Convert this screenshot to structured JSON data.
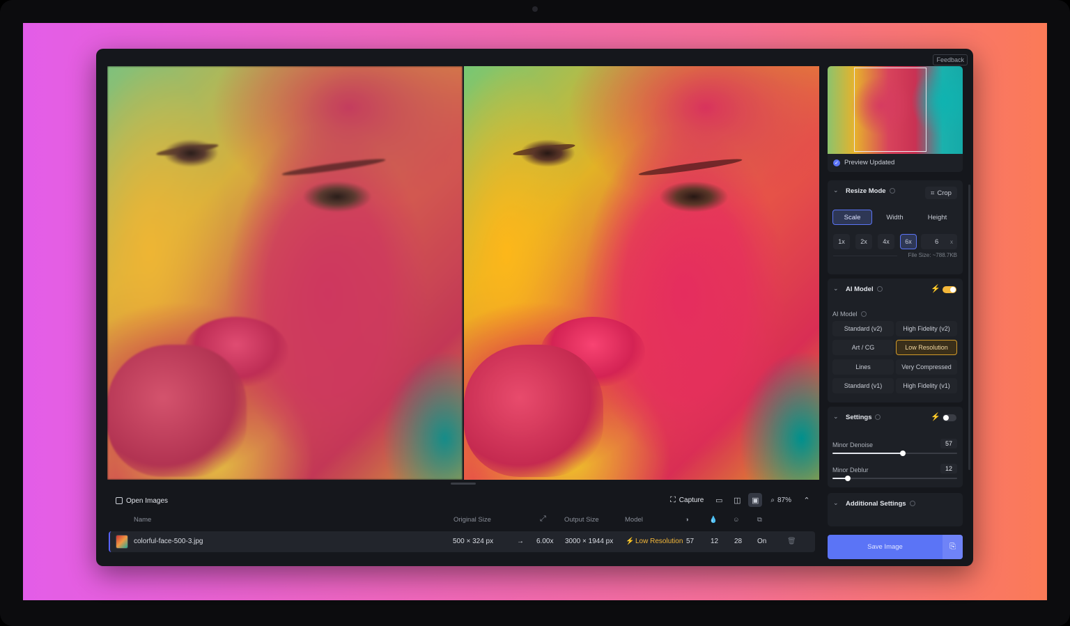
{
  "feedback_label": "Feedback",
  "preview": {
    "status": "Preview Updated"
  },
  "resize": {
    "title": "Resize Mode",
    "crop_label": "Crop",
    "modes": [
      "Scale",
      "Width",
      "Height"
    ],
    "active_mode": "Scale",
    "scales": [
      "1x",
      "2x",
      "4x",
      "6x"
    ],
    "active_scale": "6x",
    "custom_value": "6",
    "custom_suffix": "x",
    "file_size": "File Size: ~788.7KB"
  },
  "ai_model": {
    "title": "AI Model",
    "subtitle": "AI Model",
    "enabled": true,
    "options": [
      "Standard (v2)",
      "High Fidelity (v2)",
      "Art / CG",
      "Low Resolution",
      "Lines",
      "Very Compressed",
      "Standard (v1)",
      "High Fidelity (v1)"
    ],
    "active": "Low Resolution"
  },
  "settings": {
    "title": "Settings",
    "enabled": false,
    "denoise_label": "Minor Denoise",
    "denoise_value": "57",
    "deblur_label": "Minor Deblur",
    "deblur_value": "12"
  },
  "additional_settings": {
    "title": "Additional Settings"
  },
  "save": {
    "label": "Save Image"
  },
  "toolbar": {
    "open_images": "Open Images",
    "capture": "Capture",
    "zoom": "87%"
  },
  "table": {
    "headers": {
      "name": "Name",
      "original": "Original Size",
      "output": "Output Size",
      "model": "Model"
    },
    "row": {
      "name": "colorful-face-500-3.jpg",
      "original": "500 × 324 px",
      "scale": "6.00x",
      "output": "3000 × 1944 px",
      "model": "Low Resolution",
      "denoise": "57",
      "deblur": "12",
      "c3": "28",
      "face": "On"
    }
  },
  "colors": {
    "accent": "#5b74f6",
    "warning": "#f3b73a",
    "background": "#15171c"
  }
}
